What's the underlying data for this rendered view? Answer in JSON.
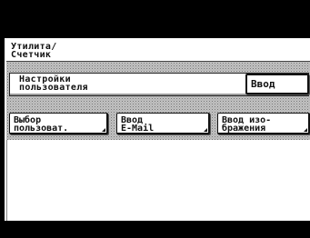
{
  "breadcrumb": {
    "line1": "Утилита/",
    "line2": "Счетчик"
  },
  "settings": {
    "title_line1": "Настройки",
    "title_line2": "пользователя"
  },
  "buttons": {
    "enter": "Ввод",
    "user_select": {
      "line1": "Выбор",
      "line2": "пользоват."
    },
    "email_entry": {
      "line1": "Ввод",
      "line2": "E-Mail"
    },
    "image_entry": {
      "line1": "Ввод изо-",
      "line2": "бражения"
    }
  }
}
